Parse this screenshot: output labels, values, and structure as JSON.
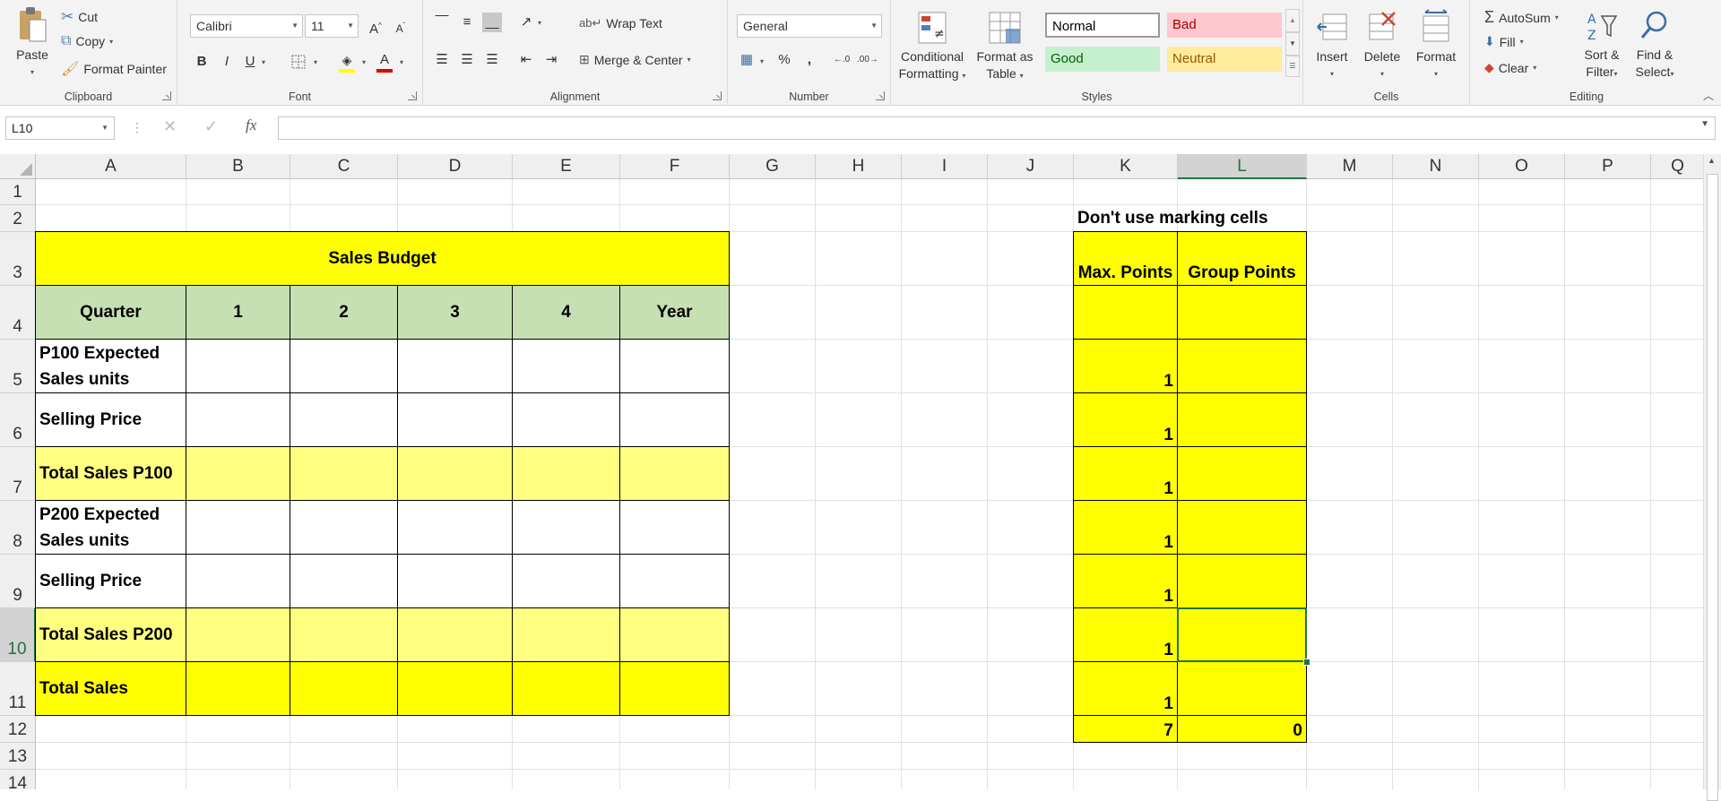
{
  "ribbon": {
    "clipboard": {
      "paste": "Paste",
      "cut": "Cut",
      "copy": "Copy",
      "format_painter": "Format Painter",
      "label": "Clipboard"
    },
    "font": {
      "name": "Calibri",
      "size": "11",
      "label": "Font",
      "bold": "B",
      "italic": "I",
      "underline": "U",
      "grow": "A",
      "shrink": "A",
      "font_color": "A"
    },
    "alignment": {
      "wrap_text": "Wrap Text",
      "merge_center": "Merge & Center",
      "label": "Alignment"
    },
    "number": {
      "format": "General",
      "label": "Number",
      "percent": "%",
      "comma": ","
    },
    "styles": {
      "conditional": [
        "Conditional",
        "Formatting"
      ],
      "format_table": [
        "Format as",
        "Table"
      ],
      "normal": "Normal",
      "bad": "Bad",
      "good": "Good",
      "neutral": "Neutral",
      "label": "Styles"
    },
    "cells": {
      "insert": "Insert",
      "delete": "Delete",
      "format": "Format",
      "label": "Cells"
    },
    "editing": {
      "autosum": "AutoSum",
      "fill": "Fill",
      "clear": "Clear",
      "sort": [
        "Sort &",
        "Filter"
      ],
      "find": [
        "Find &",
        "Select"
      ],
      "label": "Editing"
    }
  },
  "formula_bar": {
    "name_box": "L10",
    "fx": "fx",
    "content": ""
  },
  "columns": [
    "A",
    "B",
    "C",
    "D",
    "E",
    "F",
    "G",
    "H",
    "I",
    "J",
    "K",
    "L",
    "M",
    "N",
    "O",
    "P",
    "Q"
  ],
  "rows": [
    "1",
    "2",
    "3",
    "4",
    "5",
    "6",
    "7",
    "8",
    "9",
    "10",
    "11",
    "12",
    "13",
    "14"
  ],
  "selected_cell": "L10",
  "sheet": {
    "title": "Sales Budget",
    "header": [
      "Quarter",
      "1",
      "2",
      "3",
      "4",
      "Year"
    ],
    "row_labels": [
      "P100 Expected\nSales units",
      "Selling Price",
      "Total Sales P100",
      "P200 Expected\nSales units",
      "Selling Price",
      "Total Sales P200",
      "Total Sales"
    ],
    "marking": {
      "note": "Don't use marking cells",
      "max_header": "Max. Points",
      "group_header": "Group Points",
      "max_points": [
        "",
        "1",
        "1",
        "1",
        "1",
        "1",
        "1",
        "1"
      ],
      "total_max": "7",
      "total_group": "0"
    }
  },
  "colors": {
    "yellow": "#ffff00",
    "light_yellow": "#ffff80",
    "green_header": "#c6e0b4",
    "excel_green": "#217346"
  }
}
